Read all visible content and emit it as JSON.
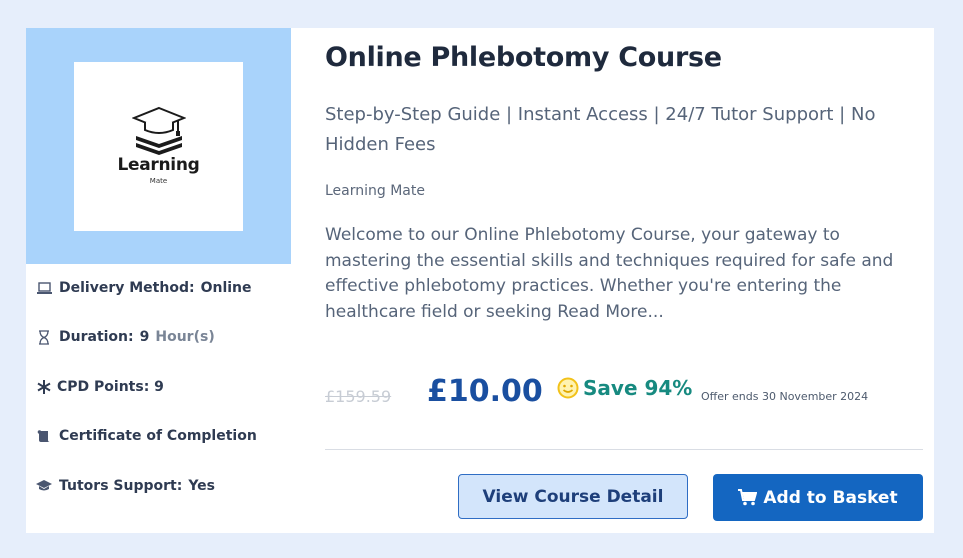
{
  "course": {
    "title": "Online Phlebotomy Course",
    "subtitle": "Step-by-Step Guide | Instant Access | 24/7 Tutor Support | No Hidden Fees",
    "provider": "Learning Mate",
    "description": "Welcome to our Online Phlebotomy Course, your gateway to mastering the essential skills and techniques required for safe and effective phlebotomy practices. Whether you're entering the healthcare field or seeking Read More..."
  },
  "logo": {
    "word": "Learning",
    "sub": "Mate",
    "icon": "graduation-cap-books-logo"
  },
  "meta": {
    "delivery": {
      "label": "Delivery Method:",
      "value": "Online",
      "icon": "laptop-icon"
    },
    "duration": {
      "label": "Duration:",
      "value": "9",
      "unit": "Hour(s)",
      "icon": "hourglass-icon"
    },
    "cpd": {
      "label": "CPD Points: 9",
      "icon": "asterisk-icon"
    },
    "certificate": {
      "label": "Certificate of Completion",
      "icon": "scroll-icon"
    },
    "tutors": {
      "label": "Tutors Support:",
      "value": "Yes",
      "icon": "graduation-cap-icon"
    }
  },
  "pricing": {
    "old_price": "£159.59",
    "price": "£10.00",
    "save": "Save 94%",
    "offer": "Offer ends 30 November 2024",
    "save_icon": "smiley-icon"
  },
  "buttons": {
    "detail": "View Course Detail",
    "basket": "Add to Basket",
    "basket_icon": "cart-icon"
  },
  "colors": {
    "page_bg": "#e6eefb",
    "logo_panel": "#a9d3fb",
    "price": "#1a4fa0",
    "save": "#178a80",
    "basket_button": "#1466c1",
    "detail_button": "#d3e5fb"
  }
}
